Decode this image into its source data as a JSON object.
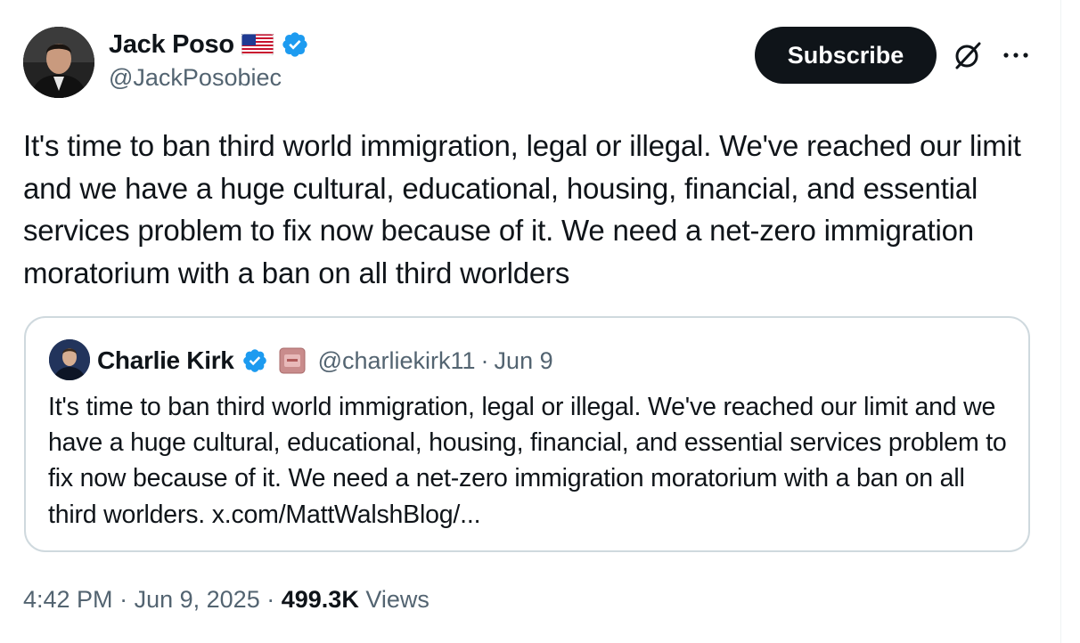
{
  "author": {
    "name": "Jack Poso",
    "handle": "@JackPosobiec",
    "flag_icon": "us-flag-icon",
    "verified_icon": "verified-badge-icon",
    "verified_color": "#1d9bf0"
  },
  "actions": {
    "subscribe_label": "Subscribe",
    "grok_icon": "grok-icon",
    "more_icon": "more-icon"
  },
  "tweet": {
    "text": "It's time to ban third world immigration, legal or illegal. We've reached our limit and we have a huge cultural, educational, housing, financial, and essential services problem to fix now because of it. We need a net-zero immigration moratorium with a ban on all third worlders"
  },
  "quoted": {
    "name": "Charlie Kirk",
    "handle": "@charliekirk11",
    "separator": "·",
    "date": "Jun 9",
    "text": "It's time to ban third world immigration, legal or illegal. We've reached our limit and we have a huge cultural, educational, housing, financial, and essential services problem to fix now because of it. We need a net-zero immigration moratorium with a ban on all third worlders. x.com/MattWalshBlog/..."
  },
  "meta": {
    "time": "4:42 PM",
    "separator": "·",
    "date": "Jun 9, 2025",
    "views_count": "499.3K",
    "views_label": "Views"
  },
  "colors": {
    "text_primary": "#0f1419",
    "text_secondary": "#536471",
    "border": "#cfd9de",
    "button_bg": "#0f1419"
  }
}
